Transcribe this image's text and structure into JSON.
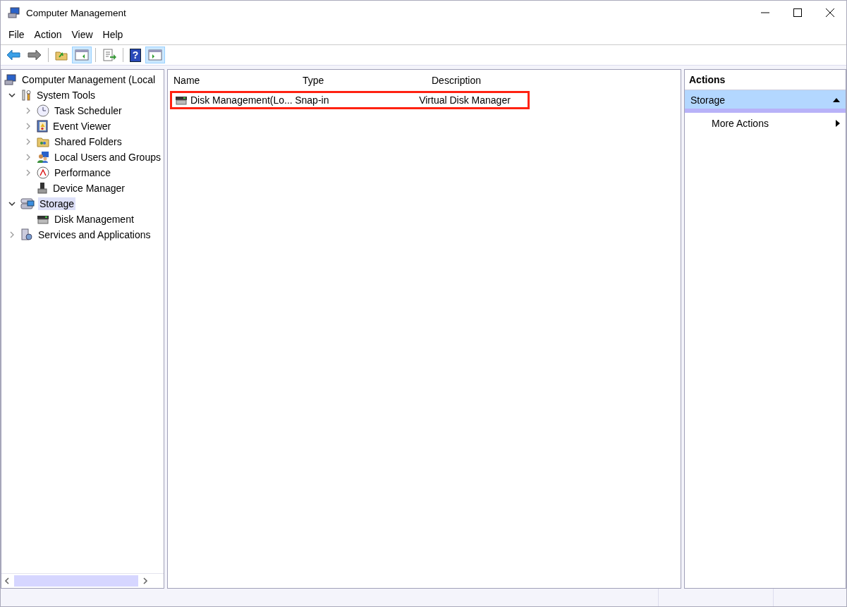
{
  "window": {
    "title": "Computer Management"
  },
  "menu": [
    "File",
    "Action",
    "View",
    "Help"
  ],
  "toolbar": [
    {
      "kind": "back",
      "on": false
    },
    {
      "kind": "forward",
      "on": false
    },
    {
      "kind": "sep"
    },
    {
      "kind": "up",
      "on": false
    },
    {
      "kind": "tree",
      "on": true
    },
    {
      "kind": "sep"
    },
    {
      "kind": "export",
      "on": false
    },
    {
      "kind": "sep"
    },
    {
      "kind": "help",
      "on": false,
      "glyph": "?"
    },
    {
      "kind": "actionpane",
      "on": true
    }
  ],
  "tree": [
    {
      "label": "Computer Management (Local",
      "selected": false,
      "children": [
        {
          "label": "System Tools",
          "selected": false,
          "expanded": true,
          "children": [
            {
              "label": "Task Scheduler",
              "selected": false,
              "expanded": false
            },
            {
              "label": "Event Viewer",
              "selected": false,
              "expanded": false
            },
            {
              "label": "Shared Folders",
              "selected": false,
              "expanded": false
            },
            {
              "label": "Local Users and Groups",
              "selected": false,
              "expanded": false
            },
            {
              "label": "Performance",
              "selected": false,
              "expanded": false
            },
            {
              "label": "Device Manager",
              "selected": false
            }
          ]
        },
        {
          "label": "Storage",
          "selected": true,
          "expanded": true,
          "children": [
            {
              "label": "Disk Management",
              "selected": false
            }
          ]
        },
        {
          "label": "Services and Applications",
          "selected": false,
          "expanded": false
        }
      ]
    }
  ],
  "list": {
    "columns": [
      "Name",
      "Type",
      "Description"
    ],
    "rows": [
      {
        "cells": [
          "Disk Management(Lo...",
          "Snap-in",
          "Virtual Disk Manager"
        ],
        "selected": false,
        "outlined": true
      }
    ]
  },
  "actions": {
    "title": "Actions",
    "groups": [
      {
        "label": "Storage",
        "expanded": true,
        "items": [
          "More Actions"
        ]
      }
    ]
  }
}
